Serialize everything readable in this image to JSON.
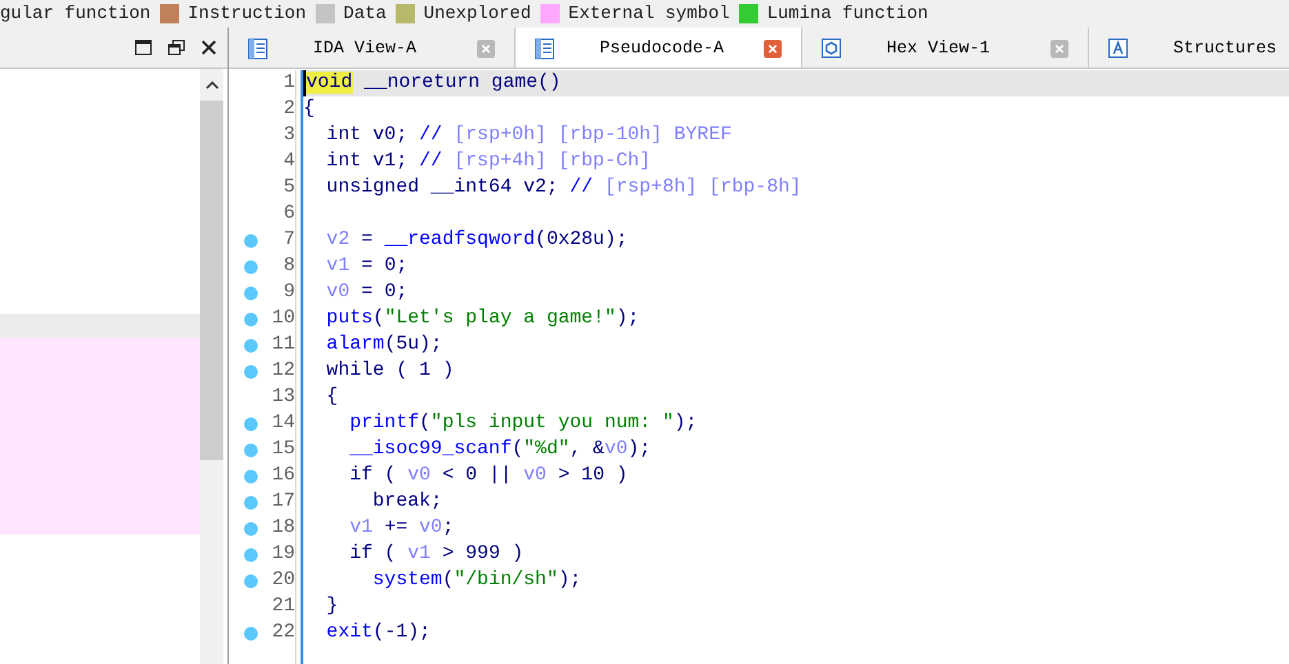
{
  "legend": [
    {
      "label": "gular function"
    },
    {
      "label": "Instruction",
      "color": "#c0805c"
    },
    {
      "label": "Data",
      "color": "#c4c4c4"
    },
    {
      "label": "Unexplored",
      "color": "#b8b86c"
    },
    {
      "label": "External symbol",
      "color": "#ffa8ff"
    },
    {
      "label": "Lumina function",
      "color": "#33cc33"
    }
  ],
  "tabs": [
    {
      "label": "IDA View-A",
      "kind": "listing",
      "selected": false,
      "closable": true
    },
    {
      "label": "Pseudocode-A",
      "kind": "listing",
      "selected": true,
      "closable": true
    },
    {
      "label": "Hex View-1",
      "kind": "hex",
      "selected": false,
      "closable": true
    },
    {
      "label": "Structures",
      "kind": "struct",
      "selected": false
    }
  ],
  "code": {
    "lines": [
      {
        "number": "1",
        "breakpoint": false,
        "current": true,
        "tokens": [
          {
            "text": "void",
            "kind": "keyword",
            "highlight": true
          },
          {
            "text": " __noreturn game()",
            "kind": "plain"
          }
        ]
      },
      {
        "number": "2",
        "breakpoint": false,
        "current": false,
        "tokens": [
          {
            "text": "{",
            "kind": "plain"
          }
        ]
      },
      {
        "number": "3",
        "breakpoint": false,
        "current": false,
        "tokens": [
          {
            "text": "  int v0; ",
            "kind": "plain"
          },
          {
            "text": "// ",
            "kind": "comment"
          },
          {
            "text": "[rsp+0h] [rbp-10h] BYREF",
            "kind": "ref"
          }
        ]
      },
      {
        "number": "4",
        "breakpoint": false,
        "current": false,
        "tokens": [
          {
            "text": "  int v1; ",
            "kind": "plain"
          },
          {
            "text": "// ",
            "kind": "comment"
          },
          {
            "text": "[rsp+4h] [rbp-Ch]",
            "kind": "ref"
          }
        ]
      },
      {
        "number": "5",
        "breakpoint": false,
        "current": false,
        "tokens": [
          {
            "text": "  unsigned __int64 v2; ",
            "kind": "plain"
          },
          {
            "text": "// ",
            "kind": "comment"
          },
          {
            "text": "[rsp+8h] [rbp-8h]",
            "kind": "ref"
          }
        ]
      },
      {
        "number": "6",
        "breakpoint": false,
        "current": false
      },
      {
        "number": "7",
        "breakpoint": true,
        "current": false,
        "tokens": [
          {
            "text": "  v2",
            "kind": "var"
          },
          {
            "text": " = ",
            "kind": "plain"
          },
          {
            "text": "__readfsqword",
            "kind": "func"
          },
          {
            "text": "(0x28u);",
            "kind": "plain"
          }
        ]
      },
      {
        "number": "8",
        "breakpoint": true,
        "current": false,
        "tokens": [
          {
            "text": "  v1",
            "kind": "var"
          },
          {
            "text": " = 0;",
            "kind": "plain"
          }
        ]
      },
      {
        "number": "9",
        "breakpoint": true,
        "current": false,
        "tokens": [
          {
            "text": "  v0",
            "kind": "var"
          },
          {
            "text": " = 0;",
            "kind": "plain"
          }
        ]
      },
      {
        "number": "10",
        "breakpoint": true,
        "current": false,
        "tokens": [
          {
            "text": "  puts",
            "kind": "func"
          },
          {
            "text": "(",
            "kind": "plain"
          },
          {
            "text": "\"Let's play a game!\"",
            "kind": "string"
          },
          {
            "text": ");",
            "kind": "plain"
          }
        ]
      },
      {
        "number": "11",
        "breakpoint": true,
        "current": false,
        "tokens": [
          {
            "text": "  alarm",
            "kind": "func"
          },
          {
            "text": "(5u);",
            "kind": "plain"
          }
        ]
      },
      {
        "number": "12",
        "breakpoint": true,
        "current": false,
        "tokens": [
          {
            "text": "  while ( 1 )",
            "kind": "plain"
          }
        ]
      },
      {
        "number": "13",
        "breakpoint": false,
        "current": false,
        "tokens": [
          {
            "text": "  {",
            "kind": "plain"
          }
        ]
      },
      {
        "number": "14",
        "breakpoint": true,
        "current": false,
        "tokens": [
          {
            "text": "    printf",
            "kind": "func"
          },
          {
            "text": "(",
            "kind": "plain"
          },
          {
            "text": "\"pls input you num: \"",
            "kind": "string"
          },
          {
            "text": ");",
            "kind": "plain"
          }
        ]
      },
      {
        "number": "15",
        "breakpoint": true,
        "current": false,
        "tokens": [
          {
            "text": "    __isoc99_scanf",
            "kind": "func"
          },
          {
            "text": "(",
            "kind": "plain"
          },
          {
            "text": "\"%d\"",
            "kind": "string"
          },
          {
            "text": ", &",
            "kind": "plain"
          },
          {
            "text": "v0",
            "kind": "var"
          },
          {
            "text": ");",
            "kind": "plain"
          }
        ]
      },
      {
        "number": "16",
        "breakpoint": true,
        "current": false,
        "tokens": [
          {
            "text": "    if ( ",
            "kind": "plain"
          },
          {
            "text": "v0",
            "kind": "var"
          },
          {
            "text": " < 0 || ",
            "kind": "plain"
          },
          {
            "text": "v0",
            "kind": "var"
          },
          {
            "text": " > 10 )",
            "kind": "plain"
          }
        ]
      },
      {
        "number": "17",
        "breakpoint": true,
        "current": false,
        "tokens": [
          {
            "text": "      break;",
            "kind": "plain"
          }
        ]
      },
      {
        "number": "18",
        "breakpoint": true,
        "current": false,
        "tokens": [
          {
            "text": "    v1",
            "kind": "var"
          },
          {
            "text": " += ",
            "kind": "plain"
          },
          {
            "text": "v0",
            "kind": "var"
          },
          {
            "text": ";",
            "kind": "plain"
          }
        ]
      },
      {
        "number": "19",
        "breakpoint": true,
        "current": false,
        "tokens": [
          {
            "text": "    if ( ",
            "kind": "plain"
          },
          {
            "text": "v1",
            "kind": "var"
          },
          {
            "text": " > 999 )",
            "kind": "plain"
          }
        ]
      },
      {
        "number": "20",
        "breakpoint": true,
        "current": false,
        "tokens": [
          {
            "text": "      system",
            "kind": "func"
          },
          {
            "text": "(",
            "kind": "plain"
          },
          {
            "text": "\"/bin/sh\"",
            "kind": "string"
          },
          {
            "text": ");",
            "kind": "plain"
          }
        ]
      },
      {
        "number": "21",
        "breakpoint": false,
        "current": false,
        "tokens": [
          {
            "text": "  }",
            "kind": "plain"
          }
        ]
      },
      {
        "number": "22",
        "breakpoint": true,
        "current": false,
        "tokens": [
          {
            "text": "  exit",
            "kind": "func"
          },
          {
            "text": "(-1);",
            "kind": "plain"
          }
        ]
      }
    ]
  }
}
